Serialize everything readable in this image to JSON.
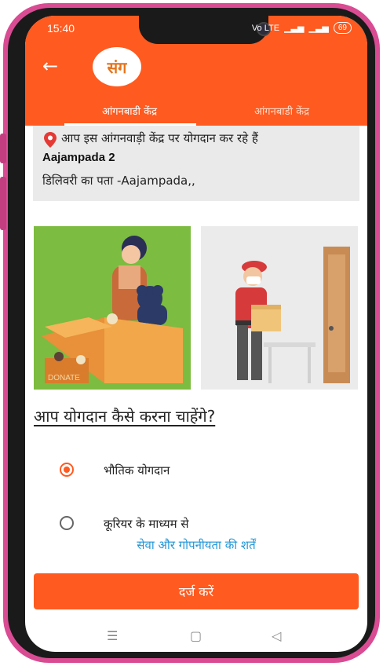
{
  "status": {
    "time": "15:40",
    "network": "Vo LTE",
    "battery": "69"
  },
  "appbar": {
    "back_icon": "arrow-left-icon",
    "logo_text": "संग"
  },
  "tabs": [
    {
      "label": "आंगनबाडी केंद्र"
    },
    {
      "label": "आंगनबाडी केंद्र"
    }
  ],
  "card": {
    "contrib_text": "आप इस आंगनवाड़ी केंद्र पर योगदान कर रहे हैं",
    "anganwadi_name": "Aajampada 2",
    "address": "डिलिवरी का पता -Aajampada,,"
  },
  "images": {
    "donate_label": "DONATE"
  },
  "question": "आप योगदान कैसे करना चाहेंगे?",
  "options": [
    {
      "label": "भौतिक योगदान",
      "selected": true
    },
    {
      "label": "कूरियर के माध्यम से",
      "selected": false
    }
  ],
  "terms_link": "सेवा और गोपनीयता की शर्तें",
  "submit_label": "दर्ज करें",
  "colors": {
    "primary": "#ff5a1f",
    "link": "#2196d6",
    "frame": "#d94c93"
  }
}
